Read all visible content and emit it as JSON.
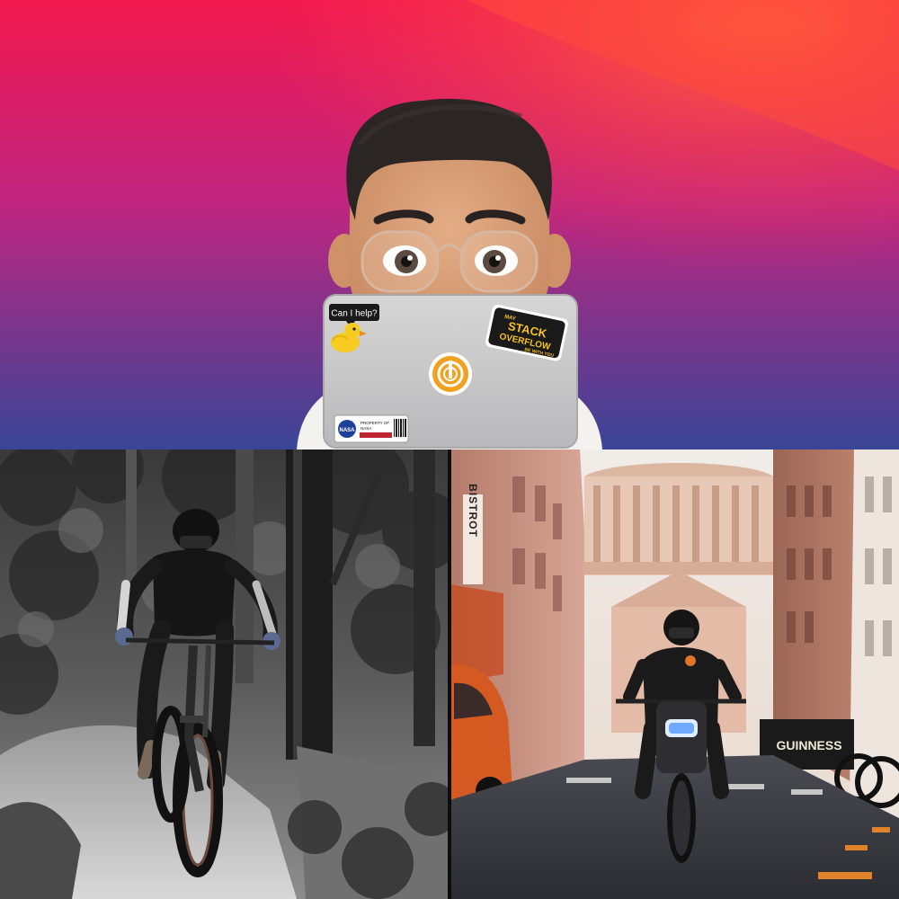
{
  "top_banner": {
    "bubble_text": "Can I help?",
    "so_sticker": {
      "top": "MAY",
      "line1": "STACK",
      "line2": "OVERFLOW",
      "bottom": "BE WITH YOU"
    },
    "nasa_sticker": {
      "logo": "NASA",
      "line1": "PROPERTY OF",
      "line2": "NASA",
      "red_line": "",
      "icon": "nasa-meatball-icon"
    },
    "center_sticker_icon": "power-stand-icon",
    "duck_icon": "rubber-duck-icon",
    "colors": {
      "gradient_top": "#f31a4e",
      "gradient_mid": "#b6287f",
      "gradient_bottom": "#3b4496",
      "laptop": "#c9c9c9",
      "so_yellow": "#f6c21a"
    }
  },
  "bottom_left": {
    "icons": [
      "mountain-bike-icon",
      "helmet-icon"
    ]
  },
  "bottom_right": {
    "sign_bistrot": "BISTROT",
    "guinness_text": "GUINNESS",
    "icons": [
      "motorcycle-icon",
      "dome-building-icon"
    ]
  }
}
